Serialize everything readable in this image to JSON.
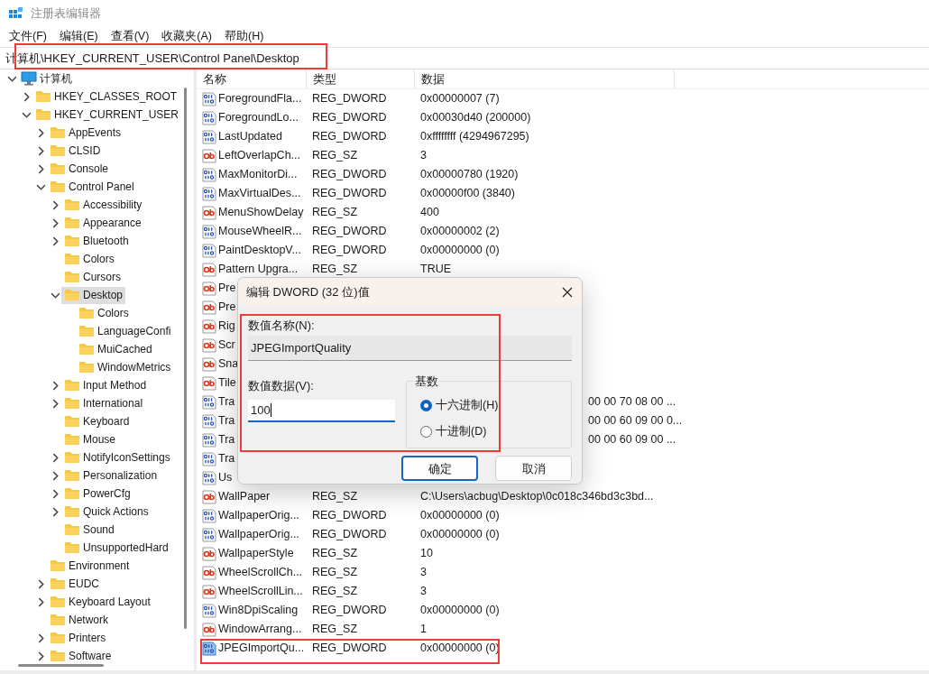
{
  "window": {
    "title": "注册表编辑器"
  },
  "menu": [
    "文件(F)",
    "编辑(E)",
    "查看(V)",
    "收藏夹(A)",
    "帮助(H)"
  ],
  "address": "计算机\\HKEY_CURRENT_USER\\Control Panel\\Desktop",
  "tree": [
    {
      "label": "计算机",
      "kind": "root",
      "expanded": true,
      "selected": false,
      "children": [
        {
          "label": "HKEY_CLASSES_ROOT",
          "kind": "branch",
          "expanded": false,
          "selected": false
        },
        {
          "label": "HKEY_CURRENT_USER",
          "kind": "branch",
          "expanded": true,
          "selected": false,
          "children": [
            {
              "label": "AppEvents",
              "kind": "branch",
              "expanded": false,
              "selected": false
            },
            {
              "label": "CLSID",
              "kind": "branch",
              "expanded": false,
              "selected": false
            },
            {
              "label": "Console",
              "kind": "branch",
              "expanded": false,
              "selected": false
            },
            {
              "label": "Control Panel",
              "kind": "branch",
              "expanded": true,
              "selected": false,
              "children": [
                {
                  "label": "Accessibility",
                  "kind": "branch",
                  "expanded": false,
                  "selected": false
                },
                {
                  "label": "Appearance",
                  "kind": "branch",
                  "expanded": false,
                  "selected": false
                },
                {
                  "label": "Bluetooth",
                  "kind": "branch",
                  "expanded": false,
                  "selected": false
                },
                {
                  "label": "Colors",
                  "kind": "leaf",
                  "selected": false
                },
                {
                  "label": "Cursors",
                  "kind": "leaf",
                  "selected": false
                },
                {
                  "label": "Desktop",
                  "kind": "branch",
                  "expanded": true,
                  "selected": true,
                  "children": [
                    {
                      "label": "Colors",
                      "kind": "leaf",
                      "selected": false
                    },
                    {
                      "label": "LanguageConfi",
                      "kind": "leaf",
                      "selected": false
                    },
                    {
                      "label": "MuiCached",
                      "kind": "leaf",
                      "selected": false
                    },
                    {
                      "label": "WindowMetrics",
                      "kind": "leaf",
                      "selected": false
                    }
                  ]
                },
                {
                  "label": "Input Method",
                  "kind": "branch",
                  "expanded": false,
                  "selected": false
                },
                {
                  "label": "International",
                  "kind": "branch",
                  "expanded": false,
                  "selected": false
                },
                {
                  "label": "Keyboard",
                  "kind": "leaf",
                  "selected": false
                },
                {
                  "label": "Mouse",
                  "kind": "leaf",
                  "selected": false
                },
                {
                  "label": "NotifyIconSettings",
                  "kind": "branch",
                  "expanded": false,
                  "selected": false
                },
                {
                  "label": "Personalization",
                  "kind": "branch",
                  "expanded": false,
                  "selected": false
                },
                {
                  "label": "PowerCfg",
                  "kind": "branch",
                  "expanded": false,
                  "selected": false
                },
                {
                  "label": "Quick Actions",
                  "kind": "branch",
                  "expanded": false,
                  "selected": false
                },
                {
                  "label": "Sound",
                  "kind": "leaf",
                  "selected": false
                },
                {
                  "label": "UnsupportedHard",
                  "kind": "leaf",
                  "selected": false
                }
              ]
            },
            {
              "label": "Environment",
              "kind": "leaf",
              "selected": false
            },
            {
              "label": "EUDC",
              "kind": "branch",
              "expanded": false,
              "selected": false
            },
            {
              "label": "Keyboard Layout",
              "kind": "branch",
              "expanded": false,
              "selected": false
            },
            {
              "label": "Network",
              "kind": "leaf",
              "selected": false
            },
            {
              "label": "Printers",
              "kind": "branch",
              "expanded": false,
              "selected": false
            },
            {
              "label": "Software",
              "kind": "branch",
              "expanded": false,
              "selected": false
            }
          ]
        }
      ]
    }
  ],
  "table": {
    "columns": [
      "名称",
      "类型",
      "数据"
    ],
    "rows": [
      {
        "name": "ForegroundFla...",
        "type": "REG_DWORD",
        "data": "0x00000007 (7)",
        "kind": "dword",
        "selected": false
      },
      {
        "name": "ForegroundLo...",
        "type": "REG_DWORD",
        "data": "0x00030d40 (200000)",
        "kind": "dword",
        "selected": false
      },
      {
        "name": "LastUpdated",
        "type": "REG_DWORD",
        "data": "0xffffffff (4294967295)",
        "kind": "dword",
        "selected": false
      },
      {
        "name": "LeftOverlapCh...",
        "type": "REG_SZ",
        "data": "3",
        "kind": "sz",
        "selected": false
      },
      {
        "name": "MaxMonitorDi...",
        "type": "REG_DWORD",
        "data": "0x00000780 (1920)",
        "kind": "dword",
        "selected": false
      },
      {
        "name": "MaxVirtualDes...",
        "type": "REG_DWORD",
        "data": "0x00000f00 (3840)",
        "kind": "dword",
        "selected": false
      },
      {
        "name": "MenuShowDelay",
        "type": "REG_SZ",
        "data": "400",
        "kind": "sz",
        "selected": false
      },
      {
        "name": "MouseWheelR...",
        "type": "REG_DWORD",
        "data": "0x00000002 (2)",
        "kind": "dword",
        "selected": false
      },
      {
        "name": "PaintDesktopV...",
        "type": "REG_DWORD",
        "data": "0x00000000 (0)",
        "kind": "dword",
        "selected": false
      },
      {
        "name": "Pattern Upgra...",
        "type": "REG_SZ",
        "data": "TRUE",
        "kind": "sz",
        "selected": false
      },
      {
        "name": "Pre",
        "kind": "sz",
        "selected": false
      },
      {
        "name": "Pre",
        "kind": "sz",
        "selected": false
      },
      {
        "name": "Rig",
        "kind": "sz",
        "selected": false
      },
      {
        "name": "Scr",
        "kind": "sz",
        "selected": false
      },
      {
        "name": "Sna",
        "kind": "sz",
        "selected": false
      },
      {
        "name": "Tile",
        "kind": "sz",
        "selected": false
      },
      {
        "name": "Tra",
        "data": "00 00 70 08 00 ...",
        "kind": "dword",
        "selected": false
      },
      {
        "name": "Tra",
        "data": "00 00 60 09 00 0...",
        "kind": "dword",
        "selected": false
      },
      {
        "name": "Tra",
        "data": "00 00 60 09 00 ...",
        "kind": "dword",
        "selected": false
      },
      {
        "name": "Tra",
        "kind": "dword",
        "selected": false
      },
      {
        "name": "Us",
        "kind": "dword",
        "selected": false
      },
      {
        "name": "WallPaper",
        "type": "REG_SZ",
        "data": "C:\\Users\\acbug\\Desktop\\0c018c346bd3c3bd...",
        "kind": "sz",
        "selected": false
      },
      {
        "name": "WallpaperOrig...",
        "type": "REG_DWORD",
        "data": "0x00000000 (0)",
        "kind": "dword",
        "selected": false
      },
      {
        "name": "WallpaperOrig...",
        "type": "REG_DWORD",
        "data": "0x00000000 (0)",
        "kind": "dword",
        "selected": false
      },
      {
        "name": "WallpaperStyle",
        "type": "REG_SZ",
        "data": "10",
        "kind": "sz",
        "selected": false
      },
      {
        "name": "WheelScrollCh...",
        "type": "REG_SZ",
        "data": "3",
        "kind": "sz",
        "selected": false
      },
      {
        "name": "WheelScrollLin...",
        "type": "REG_SZ",
        "data": "3",
        "kind": "sz",
        "selected": false
      },
      {
        "name": "Win8DpiScaling",
        "type": "REG_DWORD",
        "data": "0x00000000 (0)",
        "kind": "dword",
        "selected": false
      },
      {
        "name": "WindowArrang...",
        "type": "REG_SZ",
        "data": "1",
        "kind": "sz",
        "selected": false
      },
      {
        "name": "JPEGImportQu...",
        "type": "REG_DWORD",
        "data": "0x00000000 (0)",
        "kind": "dword",
        "selected": true
      }
    ]
  },
  "dialog": {
    "title": "编辑 DWORD (32 位)值",
    "name_label": "数值名称(N):",
    "name_value": "JPEGImportQuality",
    "data_label": "数值数据(V):",
    "data_value": "100",
    "base_label": "基数",
    "bases": [
      {
        "label": "十六进制(H)",
        "selected": true
      },
      {
        "label": "十进制(D)",
        "selected": false
      }
    ],
    "buttons": [
      {
        "label": "确定",
        "kind": "default"
      },
      {
        "label": "取消",
        "kind": "normal"
      }
    ]
  }
}
